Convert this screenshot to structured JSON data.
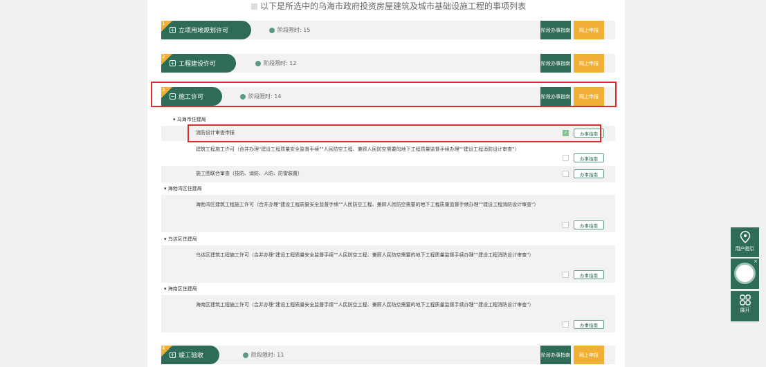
{
  "header_text": "以下是所选中的乌海市政府投资房屋建筑及城市基础设施工程的事项列表",
  "stages": [
    {
      "num": "1",
      "name": "立项用地规划许可",
      "expand_symbol": "+",
      "time": "阶段限时: 15",
      "guide": "阶段办事指南",
      "online": "网上申报"
    },
    {
      "num": "2",
      "name": "工程建设许可",
      "expand_symbol": "+",
      "time": "阶段限时: 12",
      "guide": "阶段办事指南",
      "online": "网上申报"
    },
    {
      "num": "3",
      "name": "施工许可",
      "expand_symbol": "−",
      "time": "阶段限时: 14",
      "guide": "阶段办事指南",
      "online": "网上申报"
    },
    {
      "num": "4",
      "name": "竣工验收",
      "expand_symbol": "+",
      "time": "阶段限时: 11",
      "guide": "阶段办事指南",
      "online": "网上申报"
    }
  ],
  "departments": [
    {
      "name": "▾ 乌海市住建局"
    },
    {
      "name": "▾ 海勃湾区住建局"
    },
    {
      "name": "▾ 乌达区住建局"
    },
    {
      "name": "▾ 海南区住建局"
    }
  ],
  "items": [
    {
      "text": "消防设计审查申报",
      "checked": true
    },
    {
      "text": "建筑工程施工许可（合并办理\"建设工程质量安全监督手续\"\"人民防空工程、兼顾人民防空需要的地下工程质量监督手续办理\"\"建设工程消防设计审查\"）",
      "checked": false
    },
    {
      "text": "施工图联合审查（技防、消防、人防、防雷装置）",
      "checked": false
    },
    {
      "text": "海勃湾区建筑工程施工许可（合并办理\"建设工程质量安全监督手续\"\"人民防空工程、兼顾人民防空需要的地下工程质量监督手续办理\"\"建设工程消防设计审查\"）",
      "checked": false
    },
    {
      "text": "乌达区建筑工程施工许可（合并办理\"建设工程质量安全监督手续\"\"人民防空工程、兼顾人民防空需要的地下工程质量监督手续办理\"\"建设工程消防设计审查\"）",
      "checked": false
    },
    {
      "text": "海南区建筑工程施工许可（合并办理\"建设工程质量安全监督手续\"\"人民防空工程、兼顾人民防空需要的地下工程质量监督手续办理\"\"建设工程消防设计审查\"）",
      "checked": false
    }
  ],
  "item_guide_label": "办事指南",
  "check_mark": "✓",
  "floating": {
    "user_guide": "用户指引",
    "expand": "展开",
    "close": "×"
  },
  "colors": {
    "primary": "#2f6b59",
    "accent": "#f0b038",
    "highlight": "#e02a2a"
  }
}
